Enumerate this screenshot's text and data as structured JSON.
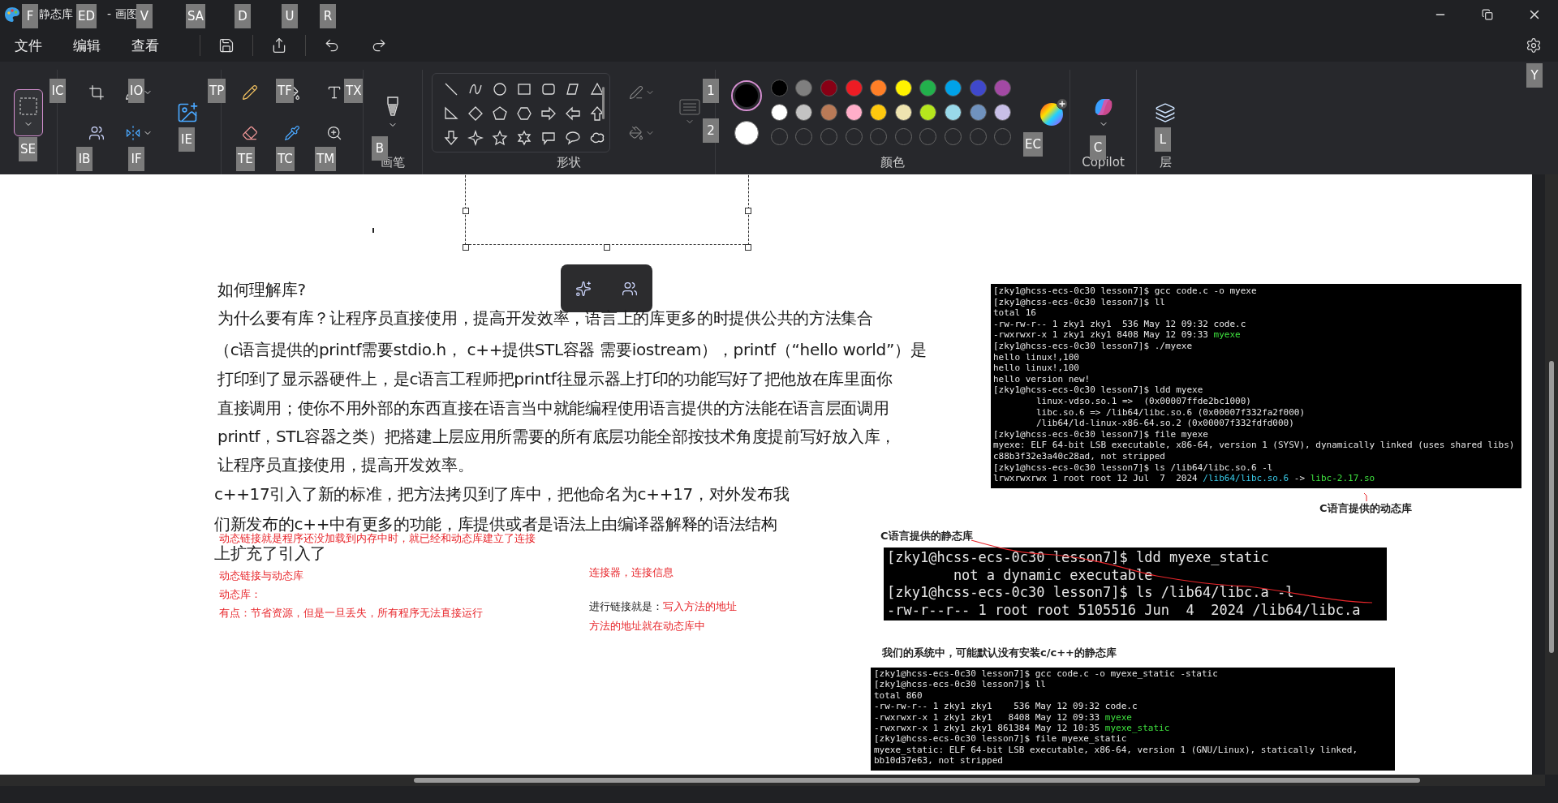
{
  "window": {
    "title_start": "静态库",
    "title_end": "- 画图"
  },
  "menu": [
    {
      "label": "文件"
    },
    {
      "label": "编辑"
    },
    {
      "label": "查看"
    }
  ],
  "ribbon": {
    "select_tool": {
      "selected": true
    },
    "group_labels": {
      "brush": "画笔",
      "shapes": "形状",
      "colors": "颜色",
      "copilot": "Copilot",
      "layers": "层"
    },
    "current_colors": [
      {
        "color": "#000000",
        "selected": true
      },
      {
        "color": "#ffffff",
        "selected": false
      }
    ],
    "palette": [
      {
        "color": "#000000"
      },
      {
        "color": "#7f7f7f"
      },
      {
        "color": "#880015"
      },
      {
        "color": "#ed1c24"
      },
      {
        "color": "#ff7f27"
      },
      {
        "color": "#fff200"
      },
      {
        "color": "#22b14c"
      },
      {
        "color": "#00a2e8"
      },
      {
        "color": "#3f48cc"
      },
      {
        "color": "#a349a4"
      },
      {
        "color": "#ffffff"
      },
      {
        "color": "#c3c3c3"
      },
      {
        "color": "#b97a57"
      },
      {
        "color": "#ffaec9"
      },
      {
        "color": "#ffc90e"
      },
      {
        "color": "#efe4b0"
      },
      {
        "color": "#b5e61d"
      },
      {
        "color": "#99d9ea"
      },
      {
        "color": "#7092be"
      },
      {
        "color": "#c8bfe7"
      }
    ]
  },
  "keytips": [
    {
      "label": "F"
    },
    {
      "label": "ED"
    },
    {
      "label": "V"
    },
    {
      "label": "SA"
    },
    {
      "label": "D"
    },
    {
      "label": "U"
    },
    {
      "label": "R"
    },
    {
      "label": "Y"
    },
    {
      "label": "SE"
    },
    {
      "label": "IC"
    },
    {
      "label": "IO"
    },
    {
      "label": "IB"
    },
    {
      "label": "IF"
    },
    {
      "label": "IE"
    },
    {
      "label": "TP"
    },
    {
      "label": "TF"
    },
    {
      "label": "TX"
    },
    {
      "label": "TE"
    },
    {
      "label": "TC"
    },
    {
      "label": "TM"
    },
    {
      "label": "B"
    },
    {
      "label": "EC"
    },
    {
      "label": "C"
    },
    {
      "label": "L"
    },
    {
      "label": "1"
    },
    {
      "label": "2"
    }
  ],
  "document": {
    "lines": [
      "如何理解库?",
      "为什么要有库？让程序员直接使用，提高开发效率，语言上的库更多的时提供公共的方法集合",
      "（c语言提供的printf需要stdio.h， c++提供STL容器 需要iostream），printf（“hello world”）是",
      "打印到了显示器硬件上，是c语言工程师把printf往显示器上打印的功能写好了把他放在库里面你",
      "直接调用；使你不用外部的东西直接在语言当中就能编程使用语言提供的方法能在语言层面调用",
      "printf，STL容器之类）把搭建上层应用所需要的所有底层功能全部按技术角度提前写好放入库，",
      "让程序员直接使用，提高开发效率。",
      "c++17引入了新的标准，把方法拷贝到了库中，把他命名为c++17，对外发布我",
      "们新发布的c++中有更多的功能，库提供或者是语法上由编译器解释的语法结构",
      "上扩充了引入了"
    ],
    "notes": [
      [
        {
          "text": "动态链接就是程序还没加载到内存中时，就已经和动态库建立了连接",
          "kind": "red"
        }
      ],
      [
        {
          "text": "动态链接与动态库",
          "kind": "red"
        }
      ],
      [
        {
          "text": "动态库：",
          "kind": "red"
        }
      ],
      [
        {
          "text": "有点：节省资源，但是一旦丢失，所有程序无法直接运行",
          "kind": "red"
        }
      ],
      [
        {
          "text": "连接器，连接信息",
          "kind": "red"
        }
      ],
      [
        {
          "text": "进行链接就是：",
          "kind": "dark"
        },
        {
          "text": "写入方法的地址",
          "kind": "red"
        }
      ],
      [
        {
          "text": "方法的地址就在动态库中",
          "kind": "red"
        }
      ]
    ],
    "captions": [
      "C语言提供的动态库",
      "C语言提供的静态库",
      "我们的系统中，可能默认没有安装c/c++的静态库"
    ],
    "terminals": [
      {
        "lines": [
          [
            {
              "text": "[zky1@hcss-ecs-0c30 lesson7]$ gcc code.c -o myexe",
              "kind": "plain"
            }
          ],
          [
            {
              "text": "[zky1@hcss-ecs-0c30 lesson7]$ ll",
              "kind": "plain"
            }
          ],
          [
            {
              "text": "total 16",
              "kind": "plain"
            }
          ],
          [
            {
              "text": "-rw-rw-r-- 1 zky1 zky1  536 May 12 09:32 code.c",
              "kind": "plain"
            }
          ],
          [
            {
              "text": "-rwxrwxr-x 1 zky1 zky1 8408 May 12 09:33 ",
              "kind": "plain"
            },
            {
              "text": "myexe",
              "kind": "exe"
            }
          ],
          [
            {
              "text": "[zky1@hcss-ecs-0c30 lesson7]$ ./myexe",
              "kind": "plain"
            }
          ],
          [
            {
              "text": "hello linux!,100",
              "kind": "plain"
            }
          ],
          [
            {
              "text": "hello linux!,100",
              "kind": "plain"
            }
          ],
          [
            {
              "text": "hello version new!",
              "kind": "plain"
            }
          ],
          [
            {
              "text": "[zky1@hcss-ecs-0c30 lesson7]$ ldd myexe",
              "kind": "plain"
            }
          ],
          [
            {
              "text": "        linux-vdso.so.1 =>  (0x00007ffde2bc1000)",
              "kind": "plain"
            }
          ],
          [
            {
              "text": "        libc.so.6 => /lib64/libc.so.6 (0x00007f332fa2f000)",
              "kind": "plain"
            }
          ],
          [
            {
              "text": "        /lib64/ld-linux-x86-64.so.2 (0x00007f332fdfd000)",
              "kind": "plain"
            }
          ],
          [
            {
              "text": "[zky1@hcss-ecs-0c30 lesson7]$ file myexe",
              "kind": "plain"
            }
          ],
          [
            {
              "text": "myexe: ELF 64-bit LSB executable, x86-64, version 1 (SYSV), dynamically linked (uses shared libs)",
              "kind": "plain"
            }
          ],
          [
            {
              "text": "c88b3f32e3a40c28ad, not stripped",
              "kind": "plain"
            }
          ],
          [
            {
              "text": "[zky1@hcss-ecs-0c30 lesson7]$ ls /lib64/libc.so.6 -l",
              "kind": "plain"
            }
          ],
          [
            {
              "text": "lrwxrwxrwx 1 root root 12 Jul  7  2024 ",
              "kind": "plain"
            },
            {
              "text": "/lib64/libc.so.6",
              "kind": "link"
            },
            {
              "text": " -> ",
              "kind": "plain"
            },
            {
              "text": "libc-2.17.so",
              "kind": "exe"
            }
          ]
        ]
      },
      {
        "lines": [
          [
            {
              "text": "[zky1@hcss-ecs-0c30 lesson7]$ ldd myexe_static",
              "kind": "plain"
            }
          ],
          [
            {
              "text": "        not a dynamic executable",
              "kind": "plain"
            }
          ],
          [
            {
              "text": "[zky1@hcss-ecs-0c30 lesson7]$ ls /lib64/libc.a -l",
              "kind": "plain"
            }
          ],
          [
            {
              "text": "-rw-r--r-- 1 root root 5105516 Jun  4  2024 /lib64/libc.a",
              "kind": "plain"
            }
          ]
        ]
      },
      {
        "lines": [
          [
            {
              "text": "[zky1@hcss-ecs-0c30 lesson7]$ gcc code.c -o myexe_static -static",
              "kind": "plain"
            }
          ],
          [
            {
              "text": "[zky1@hcss-ecs-0c30 lesson7]$ ll",
              "kind": "plain"
            }
          ],
          [
            {
              "text": "total 860",
              "kind": "plain"
            }
          ],
          [
            {
              "text": "-rw-rw-r-- 1 zky1 zky1    536 May 12 09:32 code.c",
              "kind": "plain"
            }
          ],
          [
            {
              "text": "-rwxrwxr-x 1 zky1 zky1   8408 May 12 09:33 ",
              "kind": "plain"
            },
            {
              "text": "myexe",
              "kind": "exe"
            }
          ],
          [
            {
              "text": "-rwxrwxr-x 1 zky1 zky1 861384 May 12 10:35 ",
              "kind": "plain"
            },
            {
              "text": "myexe_static",
              "kind": "exe"
            }
          ],
          [
            {
              "text": "[zky1@hcss-ecs-0c30 lesson7]$ file myexe_static",
              "kind": "plain"
            }
          ],
          [
            {
              "text": "myexe_static: ELF 64-bit LSB executable, x86-64, version 1 (GNU/Linux), statically linked,",
              "kind": "plain"
            }
          ],
          [
            {
              "text": "bb10d37e63, not stripped",
              "kind": "plain"
            }
          ]
        ]
      }
    ]
  }
}
